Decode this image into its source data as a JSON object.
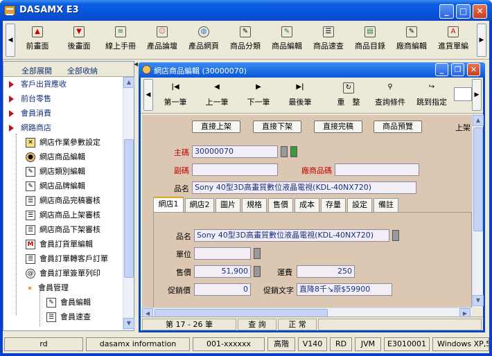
{
  "window": {
    "title": "DASAMX E3"
  },
  "toolbar": [
    {
      "label": "前畫面"
    },
    {
      "label": "後畫面"
    },
    {
      "label": "線上手冊"
    },
    {
      "label": "產品論壇"
    },
    {
      "label": "產品網頁"
    },
    {
      "label": "商品分類"
    },
    {
      "label": "商品編輯"
    },
    {
      "label": "商品速查"
    },
    {
      "label": "商品目錄"
    },
    {
      "label": "廠商編輯"
    },
    {
      "label": "進貨單編"
    }
  ],
  "sidebar": {
    "expand_all": "全部展開",
    "collapse_all": "全部收納",
    "items": [
      {
        "label": "客戶出貨應收"
      },
      {
        "label": "前台零售"
      },
      {
        "label": "會員消費"
      },
      {
        "label": "網路商店"
      },
      {
        "label": "網店作業參數設定"
      },
      {
        "label": "網店商品編輯"
      },
      {
        "label": "網店類別編輯"
      },
      {
        "label": "網店品牌編輯"
      },
      {
        "label": "網店商品完稿審核"
      },
      {
        "label": "網店商品上架審核"
      },
      {
        "label": "網店商品下架審核"
      },
      {
        "label": "會員訂貨單編輯"
      },
      {
        "label": "會員訂單轉客戶訂單"
      },
      {
        "label": "會員訂單簽單列印"
      },
      {
        "label": "會員管理"
      },
      {
        "label": "會員編輯"
      },
      {
        "label": "會員速查"
      }
    ]
  },
  "child": {
    "title": "網店商品編輯 (30000070)",
    "nav": [
      {
        "label": "第一筆"
      },
      {
        "label": "上一筆"
      },
      {
        "label": "下一筆"
      },
      {
        "label": "最後筆"
      },
      {
        "label": "重　整"
      },
      {
        "label": "查詢條件"
      },
      {
        "label": "跳到指定"
      }
    ],
    "actions": [
      {
        "label": "直接上架"
      },
      {
        "label": "直接下架"
      },
      {
        "label": "直接完稿"
      },
      {
        "label": "商品預覽"
      }
    ],
    "truncated_right": "上架",
    "form": {
      "main_code_label": "主碼",
      "main_code_value": "30000070",
      "sub_code_label": "副碼",
      "sub_code_value": "",
      "vendor_code_label": "廠商品碼",
      "vendor_code_value": "",
      "name_label": "品名",
      "name_value": "Sony 40型3D高畫質數位液晶電視(KDL-40NX720)"
    },
    "tabs": [
      {
        "label": "網店1"
      },
      {
        "label": "網店2"
      },
      {
        "label": "圖片"
      },
      {
        "label": "規格"
      },
      {
        "label": "售價"
      },
      {
        "label": "成本"
      },
      {
        "label": "存量"
      },
      {
        "label": "設定"
      },
      {
        "label": "備註"
      }
    ],
    "tab_panel": {
      "name_label": "品名",
      "name_value": "Sony 40型3D高畫質數位液晶電視(KDL-40NX720)",
      "unit_label": "單位",
      "unit_value": "",
      "price_label": "售價",
      "price_value": "51,900",
      "shipping_label": "運費",
      "shipping_value": "250",
      "promo_price_label": "促銷價",
      "promo_price_value": "0",
      "promo_text_label": "促銷文字",
      "promo_text_value": "直降8千↘原$59900"
    },
    "status": {
      "range": "第 17 - 26 筆",
      "mode": "查 詢",
      "state": "正 常"
    }
  },
  "statusbar": [
    {
      "text": "rd"
    },
    {
      "text": "dasamx information"
    },
    {
      "text": "001-xxxxxx"
    },
    {
      "text": "高階"
    },
    {
      "text": "V140"
    },
    {
      "text": "RD"
    },
    {
      "text": "JVM"
    },
    {
      "text": "E3010001"
    },
    {
      "text": "Windows XP,5"
    }
  ],
  "colors": {
    "title_blue": "#0c5ee0",
    "form_bg": "#dcc7b3",
    "label_red": "#c00000",
    "tree_red_arrow": "#c1121f"
  }
}
